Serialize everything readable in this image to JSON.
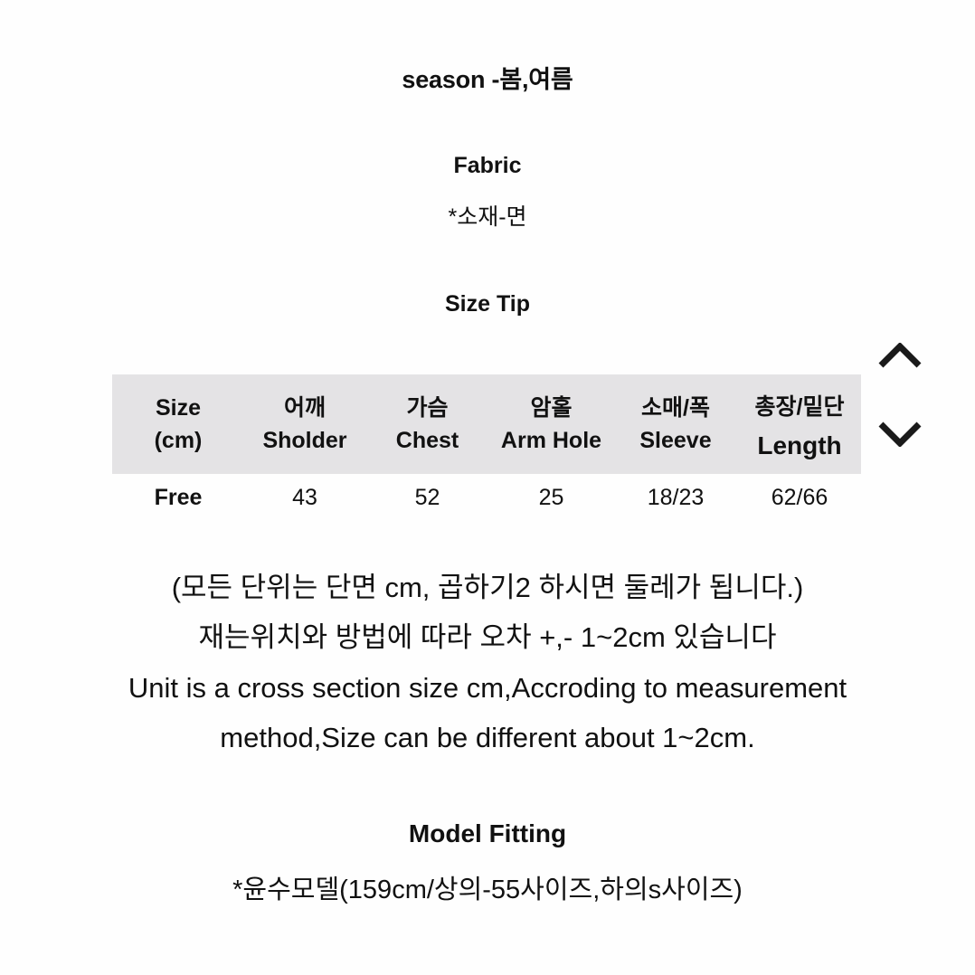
{
  "season": {
    "text": "season -봄,여름"
  },
  "fabric": {
    "title": "Fabric",
    "value": "*소재-면"
  },
  "size_tip": {
    "title": "Size Tip"
  },
  "size_table": {
    "columns": [
      {
        "kr": "Size",
        "en": "(cm)"
      },
      {
        "kr": "어깨",
        "en": "Sholder"
      },
      {
        "kr": "가슴",
        "en": "Chest"
      },
      {
        "kr": "암홀",
        "en": "Arm Hole"
      },
      {
        "kr": "소매/폭",
        "en": "Sleeve"
      },
      {
        "kr": "총장/밑단",
        "en": "Length"
      }
    ],
    "rows": [
      {
        "size": "Free",
        "shoulder": "43",
        "chest": "52",
        "arm_hole": "25",
        "sleeve": "18/23",
        "length": "62/66"
      }
    ],
    "header_background": "#e4e3e5"
  },
  "scroll_controls": {
    "up_icon": "chevron-up-icon",
    "down_icon": "chevron-down-icon"
  },
  "notes": {
    "kr_line_1": "(모든 단위는 단면 cm, 곱하기2 하시면 둘레가 됩니다.)",
    "kr_line_2": "재는위치와 방법에 따라 오차 +,- 1~2cm 있습니다",
    "en_line_1": "Unit is a cross section size cm,Accroding to measurement",
    "en_line_2": "method,Size can be different about 1~2cm."
  },
  "model_fitting": {
    "title": "Model Fitting",
    "value": "*윤수모델(159cm/상의-55사이즈,하의s사이즈)"
  },
  "colors": {
    "background": "#fefefe",
    "text": "#111111",
    "table_header": "#e4e3e5"
  }
}
